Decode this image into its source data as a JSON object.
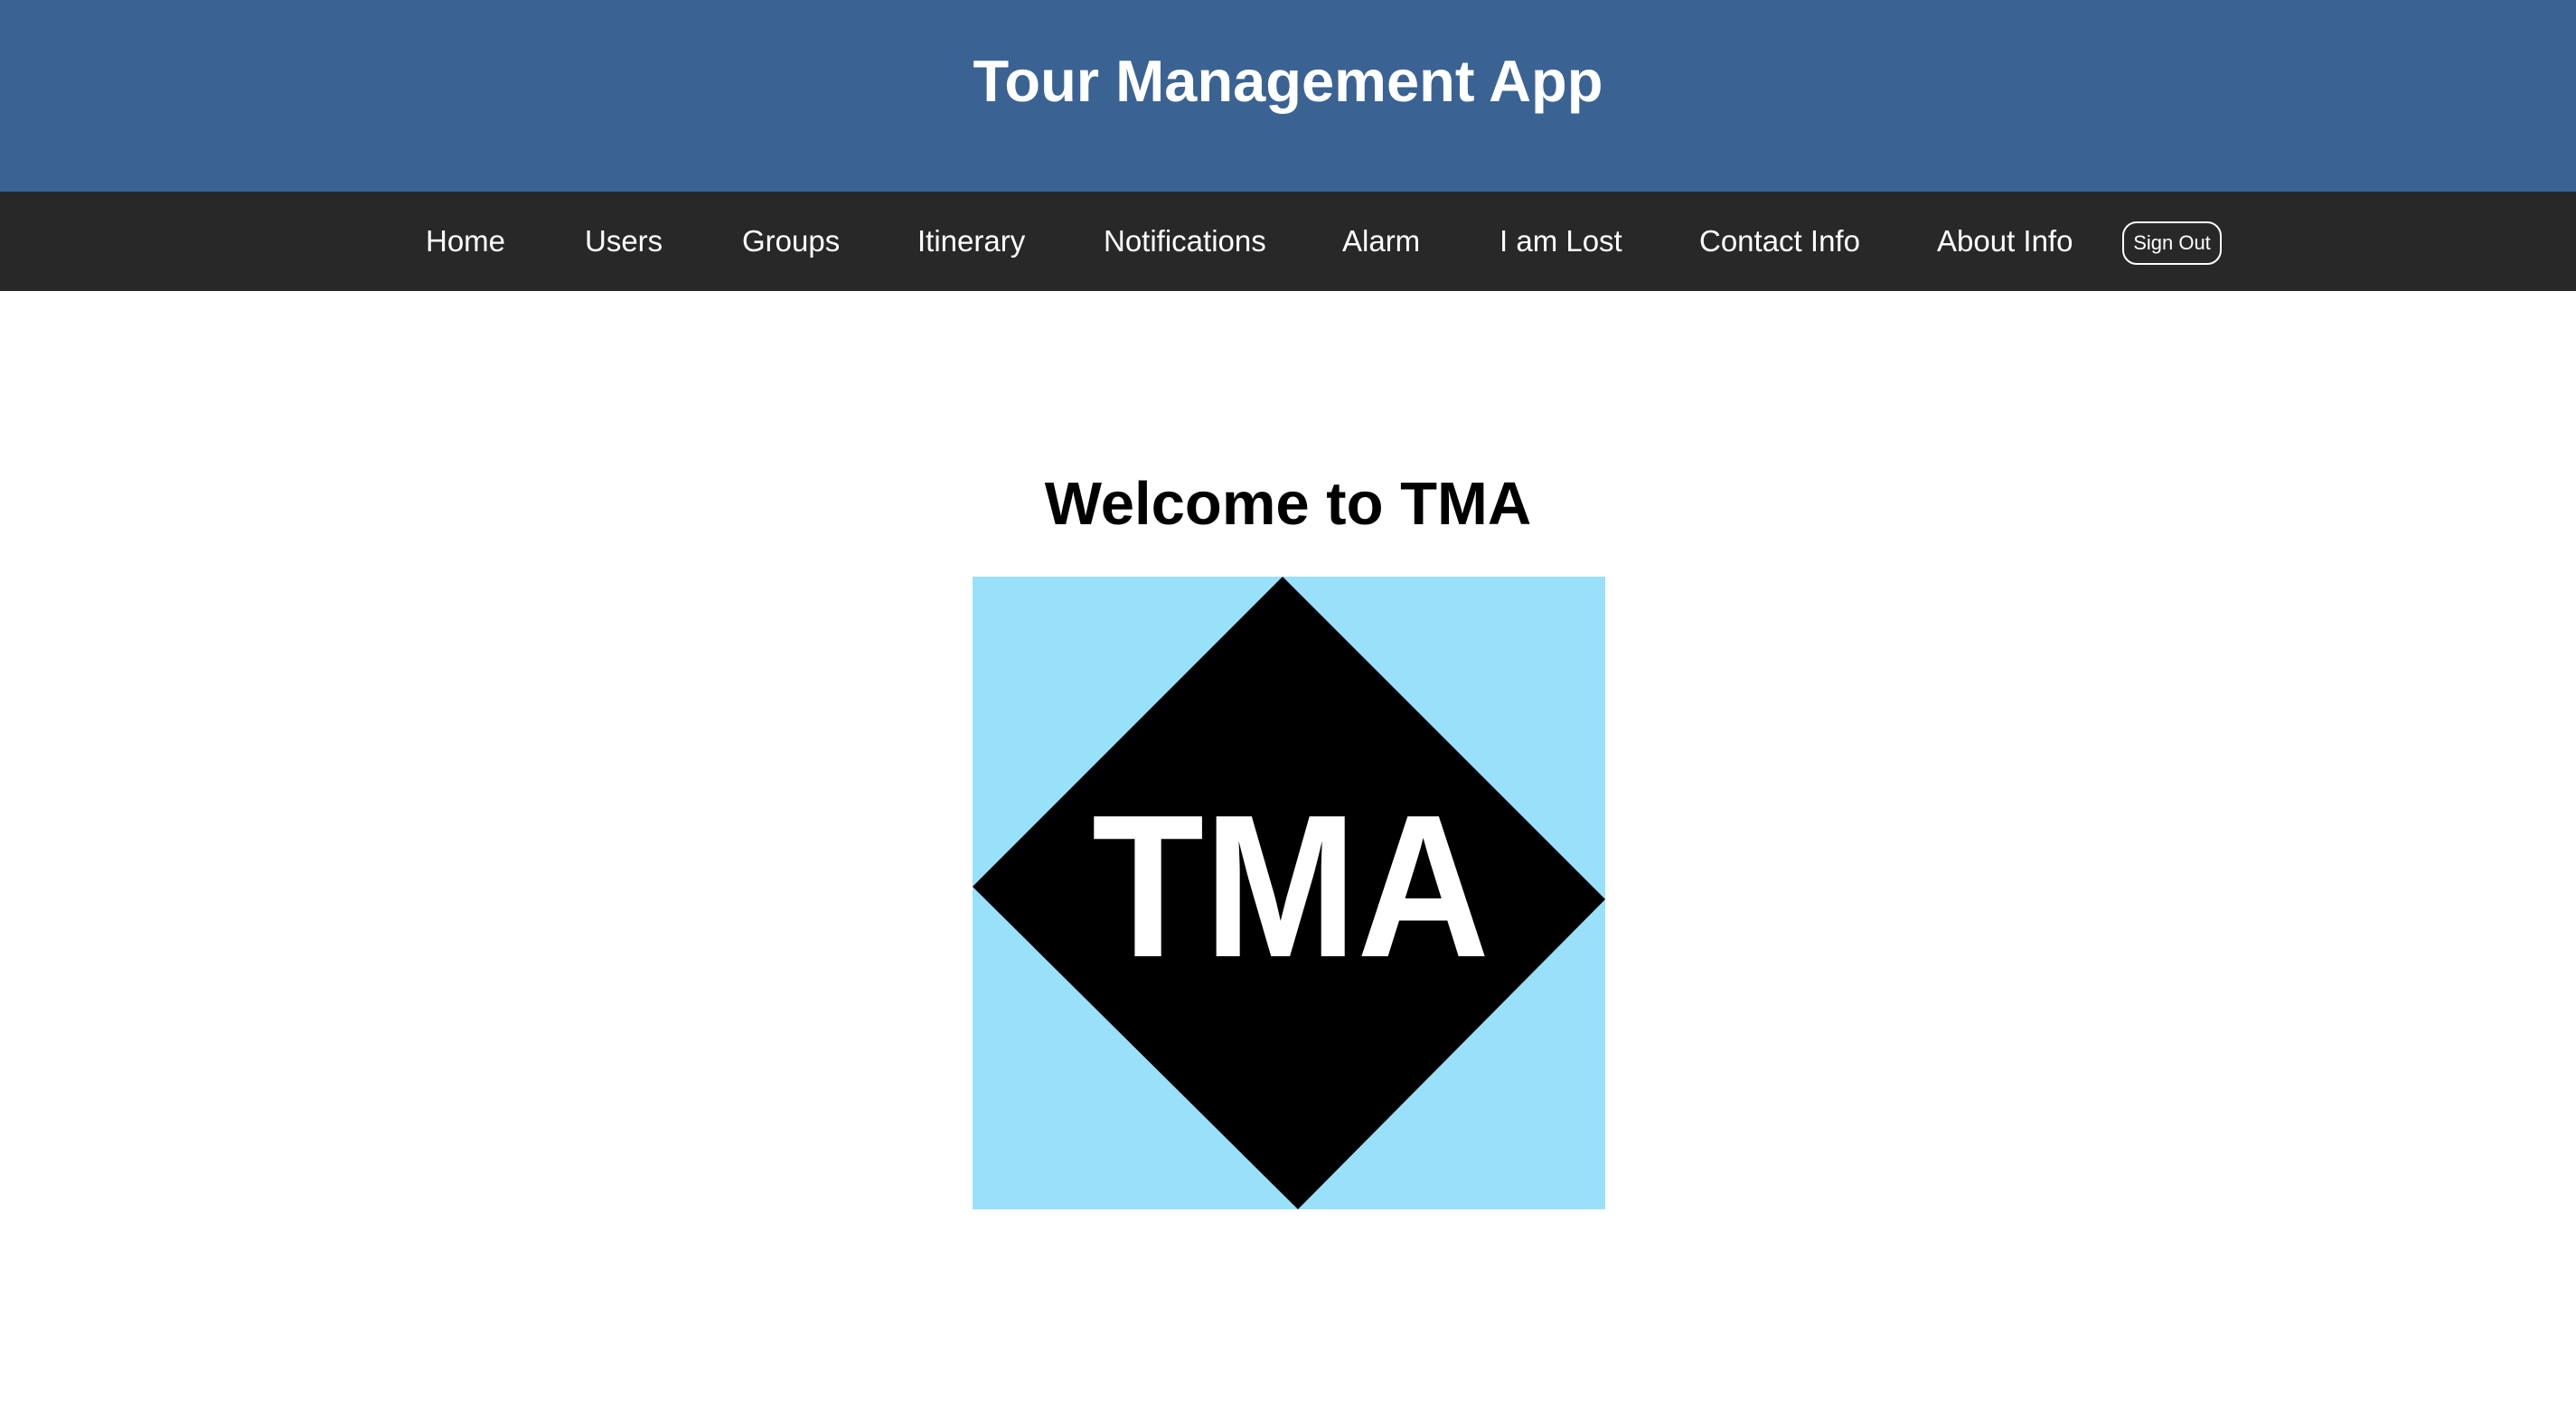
{
  "header": {
    "title": "Tour Management App"
  },
  "nav": {
    "items": [
      {
        "label": "Home"
      },
      {
        "label": "Users"
      },
      {
        "label": "Groups"
      },
      {
        "label": "Itinerary"
      },
      {
        "label": "Notifications"
      },
      {
        "label": "Alarm"
      },
      {
        "label": "I am Lost"
      },
      {
        "label": "Contact Info"
      },
      {
        "label": "About Info"
      }
    ],
    "signout_label": "Sign Out"
  },
  "main": {
    "welcome": "Welcome to TMA",
    "logo": {
      "text": "TMA",
      "background_color": "#99e0fa",
      "diamond_color": "#000000",
      "text_color": "#ffffff"
    }
  },
  "colors": {
    "header_bg": "#3a6394",
    "nav_bg": "#282828"
  }
}
